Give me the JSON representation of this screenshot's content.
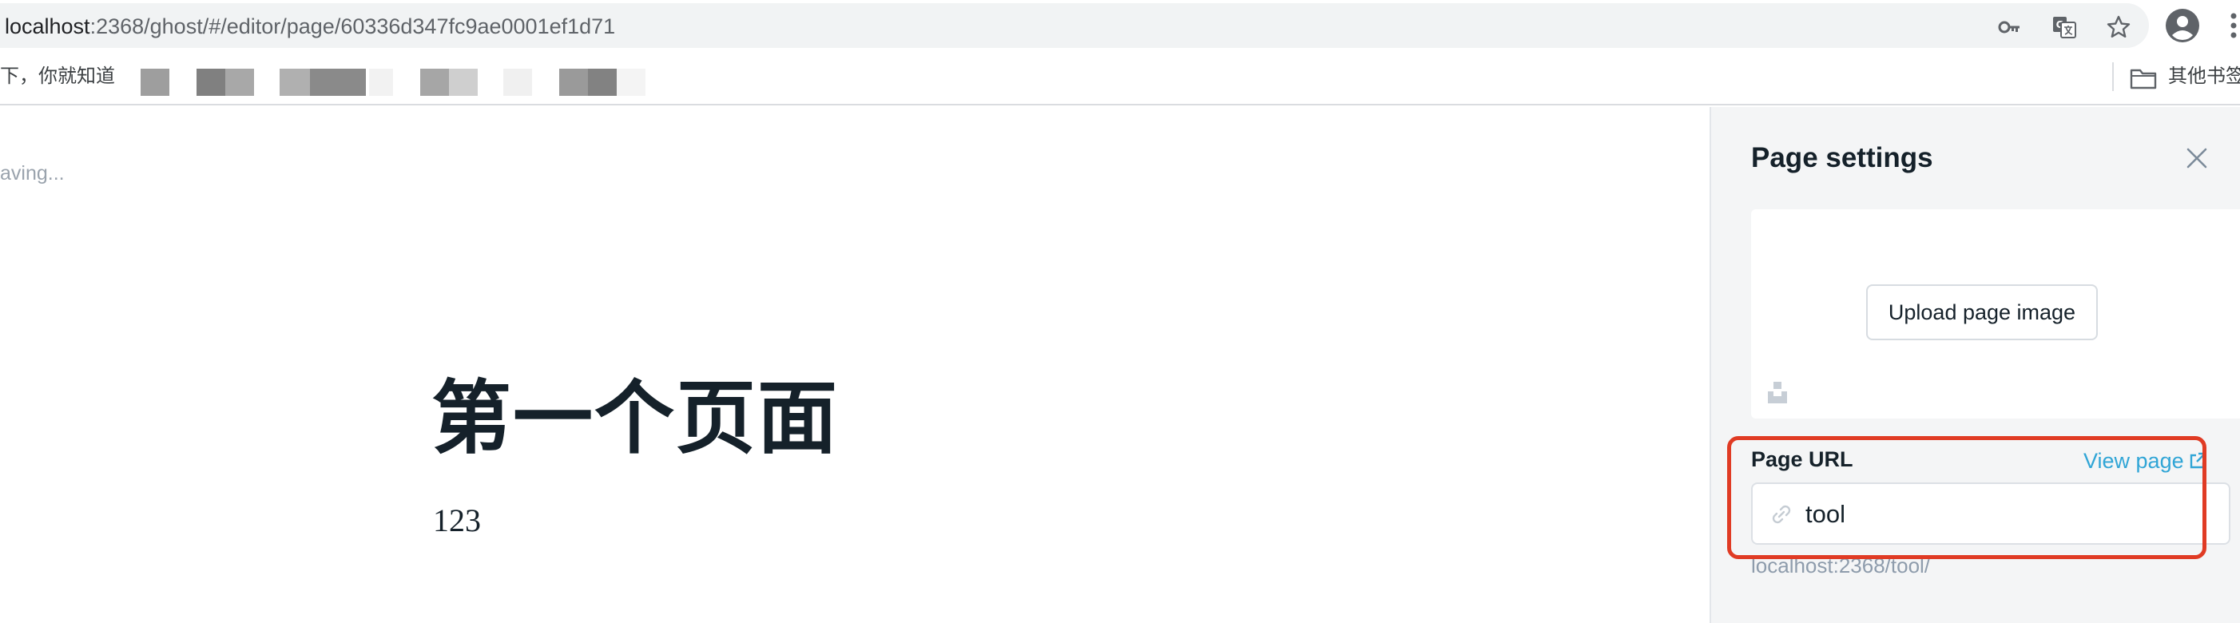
{
  "browser": {
    "url_host": "localhost",
    "url_rest": ":2368/ghost/#/editor/page/60336d347fc9ae0001ef1d71",
    "icons": [
      "key-icon",
      "translate-icon",
      "star-icon",
      "profile-avatar-icon",
      "more-vert-icon"
    ]
  },
  "bookmarks": {
    "first_label": "下，你就知道",
    "folder_label": "其他书签"
  },
  "editor": {
    "save_status": "aving...",
    "title": "第一个页面",
    "body": "123"
  },
  "settings": {
    "title": "Page settings",
    "upload_label": "Upload page image",
    "url_label": "Page URL",
    "view_page_label": "View page",
    "slug_value": "tool",
    "full_url": "localhost:2368/tool/"
  },
  "colors": {
    "accent_link": "#30a5d6",
    "highlight": "#e03b24",
    "panel_bg": "#f4f5f6",
    "title_text": "#15212a"
  }
}
